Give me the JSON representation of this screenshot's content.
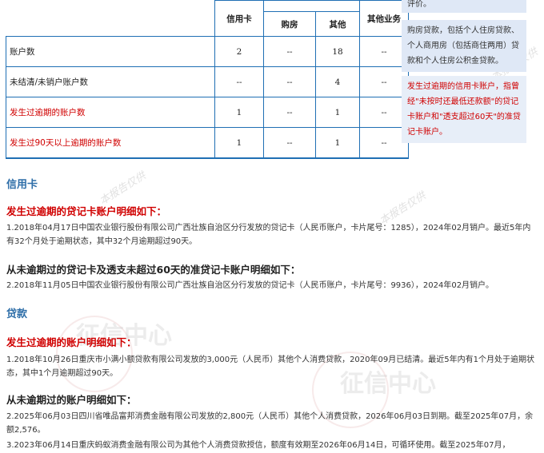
{
  "table": {
    "headers": {
      "credit_card": "信用卡",
      "mortgage": "购房",
      "other": "其他",
      "other_business": "其他业务"
    },
    "rows": [
      {
        "label": "账户数",
        "credit_card": "2",
        "mortgage": "--",
        "other": "18",
        "other_business": "--",
        "highlight": false
      },
      {
        "label": "未结清/未销户账户数",
        "credit_card": "--",
        "mortgage": "--",
        "other": "4",
        "other_business": "--",
        "highlight": false
      },
      {
        "label": "发生过逾期的账户数",
        "credit_card": "1",
        "mortgage": "--",
        "other": "1",
        "other_business": "--",
        "highlight": true
      },
      {
        "label": "发生过90天以上逾期的账户数",
        "credit_card": "1",
        "mortgage": "--",
        "other": "1",
        "other_business": "--",
        "highlight": true
      }
    ]
  },
  "notes": {
    "top": "评价。",
    "loan_note": "购房贷款，包括个人住房贷款、个人商用房（包括商住两用）贷款和个人住房公积金贷款。",
    "overdue_note": "发生过逾期的信用卡账户，指曾经\"未按时还最低还款额\"的贷记卡账户和\"透支超过60天\"的准贷记卡账户。"
  },
  "credit_card_section": {
    "title": "信用卡",
    "overdue_heading": "发生过逾期的贷记卡账户明细如下：",
    "overdue_detail": "1.2018年04月17日中国农业银行股份有限公司广西壮族自治区分行发放的贷记卡（人民币账户，卡片尾号：1285），2024年02月销户。最近5年内有32个月处于逾期状态，其中32个月逾期超过90天。",
    "normal_heading": "从未逾期过的贷记卡及透支未超过60天的准贷记卡账户明细如下：",
    "normal_detail": "2.2018年11月05日中国农业银行股份有限公司广西壮族自治区分行发放的贷记卡（人民币账户，卡片尾号：9936），2024年02月销户。"
  },
  "loan_section": {
    "title": "贷款",
    "overdue_heading": "发生过逾期的账户明细如下：",
    "overdue_detail": "1.2018年10月26日重庆市小满小额贷款有限公司发放的3,000元（人民币）其他个人消费贷款，2020年09月已结清。最近5年内有1个月处于逾期状态，其中1个月逾期超过90天。",
    "normal_heading": "从未逾期过的账户明细如下：",
    "normal_detail_1": "2.2025年06月03日四川省唯品富邦消费金融有限公司发放的2,800元（人民币）其他个人消费贷款，2026年06月03日到期。截至2025年07月，余额2,576。",
    "normal_detail_2": "3.2023年06月14日重庆蚂蚁消费金融有限公司为其他个人消费贷款授信，额度有效期至2026年06月14日，可循环使用。截至2025年07月，"
  },
  "watermark": {
    "line1": "本报告仅供",
    "seal": "征信中心"
  }
}
